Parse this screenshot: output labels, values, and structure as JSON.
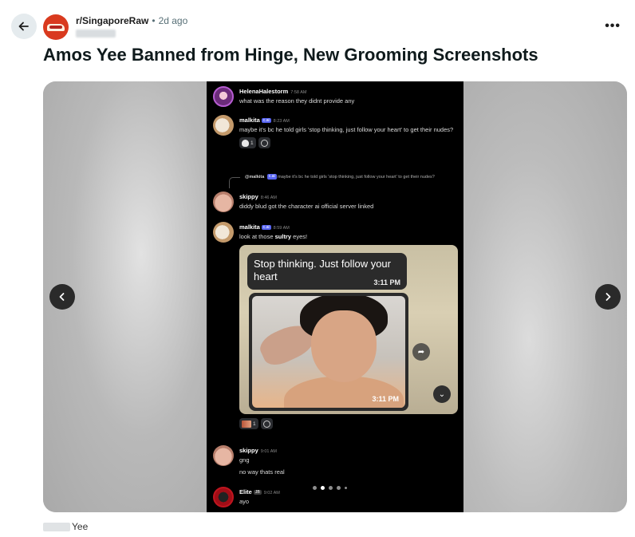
{
  "post": {
    "subreddit": "r/SingaporeRaw",
    "separator": "•",
    "age": "2d ago",
    "title": "Amos Yee Banned from Hinge, New Grooming Screenshots",
    "more_label": "•••",
    "caption": "Yee"
  },
  "gallery": {
    "active_index": 2,
    "total": 5
  },
  "chat": {
    "messages": [
      {
        "author": "HelenaHalestorm",
        "time": "7:58 AM",
        "text": "what was the reason they didnt provide any"
      },
      {
        "author": "malkita",
        "tag": "c.ai",
        "time": "8:23 AM",
        "text": "maybe it's bc he told girls 'stop thinking, just follow your heart' to get their nudes?",
        "reaction_count": "1"
      },
      {
        "reply_author": "@malkita",
        "reply_tag": "c.ai",
        "reply_text": "maybe it's bc he told girls 'stop thinking, just follow your heart' to get their nudes?",
        "author": "skippy",
        "time": "8:46 AM",
        "text": "diddy blud got the character ai official server linked"
      },
      {
        "author": "malkita",
        "tag": "c.ai",
        "time": "8:59 AM",
        "text_before": "look at those ",
        "text_bold": "sultry",
        "text_after": " eyes!",
        "reaction_count": "1"
      },
      {
        "author": "skippy",
        "time": "9:01 AM",
        "text": "gng",
        "text2": "no way thats real"
      },
      {
        "author": "Elite",
        "tag": "JB",
        "time": "9:02 AM",
        "text": "ayo"
      }
    ],
    "embed": {
      "bubble_text": "Stop thinking. Just follow your heart",
      "bubble_time": "3:11 PM",
      "photo_time": "3:11 PM"
    }
  },
  "colors": {
    "accent_discord": "#5865f2",
    "subreddit_icon": "#d93a1e",
    "title": "#0f1a1c"
  }
}
